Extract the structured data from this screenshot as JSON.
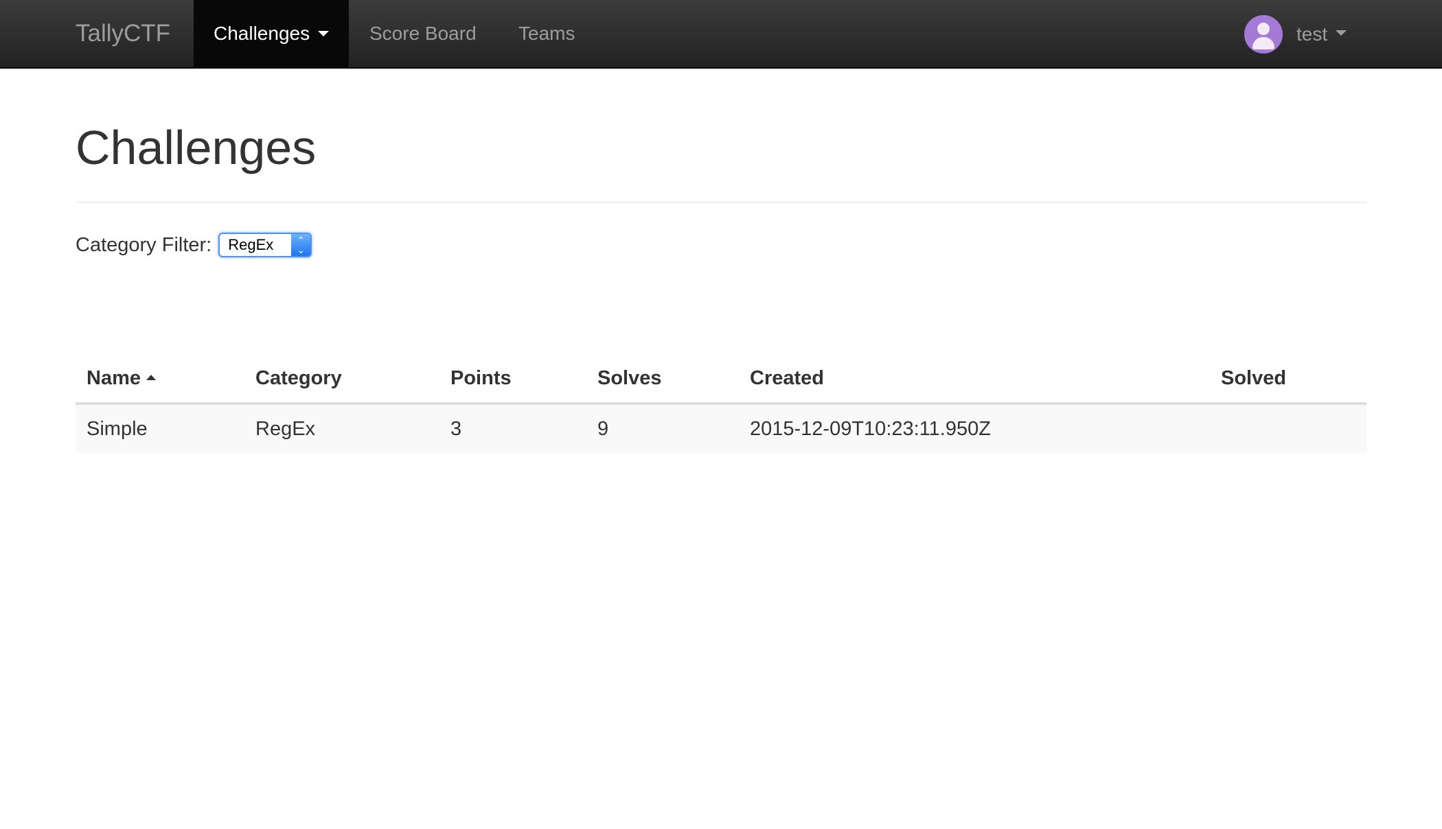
{
  "navbar": {
    "brand": "TallyCTF",
    "items": [
      {
        "label": "Challenges",
        "active": true,
        "dropdown": true
      },
      {
        "label": "Score Board"
      },
      {
        "label": "Teams"
      }
    ],
    "user": {
      "name": "test",
      "avatar_icon": "user-avatar-icon",
      "avatar_color": "#a57ad6"
    }
  },
  "page": {
    "title": "Challenges"
  },
  "filter": {
    "label": "Category Filter:",
    "selected": "RegEx"
  },
  "table": {
    "headers": [
      "Name",
      "Category",
      "Points",
      "Solves",
      "Created",
      "Solved"
    ],
    "sorted_by": "Name",
    "sort_direction": "ascending",
    "rows": [
      {
        "name": "Simple",
        "category": "RegEx",
        "points": "3",
        "solves": "9",
        "created": "2015-12-09T10:23:11.950Z",
        "solved": ""
      }
    ]
  },
  "colors": {
    "navbar_bg": "#222222",
    "active_nav_bg": "#080808",
    "select_focus": "#4d90fe"
  }
}
